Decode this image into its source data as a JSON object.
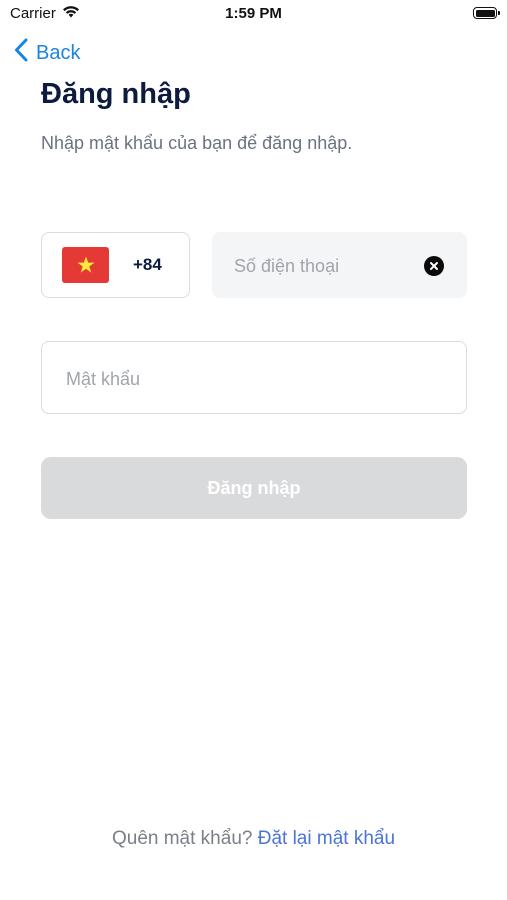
{
  "status_bar": {
    "carrier": "Carrier",
    "time": "1:59 PM",
    "battery_level": 1.0
  },
  "nav": {
    "back_label": "Back"
  },
  "header": {
    "title": "Đăng nhập",
    "subtitle": "Nhập mật khẩu của bạn để đăng nhập."
  },
  "form": {
    "country": {
      "flag": "vietnam-flag",
      "dial_code": "+84"
    },
    "phone": {
      "placeholder": "Số điện thoại",
      "value": ""
    },
    "password": {
      "placeholder": "Mật khẩu",
      "value": ""
    },
    "submit_label": "Đăng nhập"
  },
  "footer": {
    "forgot_question": "Quên mật khẩu?",
    "reset_link": "Đặt lại mật khẩu"
  },
  "colors": {
    "accent": "#1a84e4",
    "title": "#0d1b3e",
    "link": "#4b73d8",
    "button_disabled": "#d9dadc",
    "flag_red": "#e53935",
    "flag_star": "#ffeb3b"
  }
}
